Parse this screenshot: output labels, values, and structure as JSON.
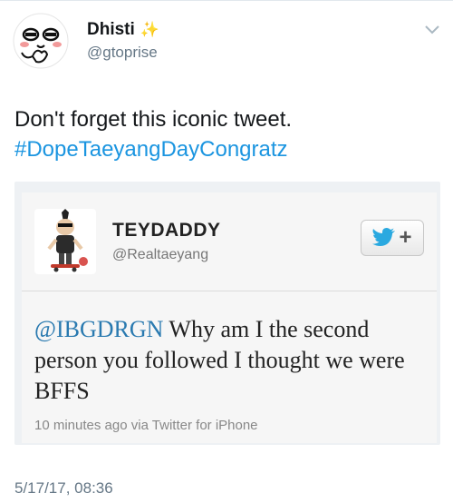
{
  "user": {
    "display_name": "Dhisti",
    "name_emoji": "✨",
    "handle": "@gtoprise"
  },
  "tweet": {
    "text": "Don't forget this iconic tweet.",
    "hashtag": "#DopeTaeyangDayCongratz",
    "timestamp": "5/17/17, 08:36"
  },
  "embedded": {
    "display_name": "TEYDADDY",
    "handle": "@Realtaeyang",
    "follow_plus": "+",
    "mention": "@IBGDRGN",
    "body": " Why am I the second person you followed I thought we were BFFS",
    "meta": "10 minutes ago via Twitter for iPhone"
  },
  "colors": {
    "hashtag": "#1b95e0",
    "handle_gray": "#657786",
    "sparkle": "#f7c52b"
  }
}
